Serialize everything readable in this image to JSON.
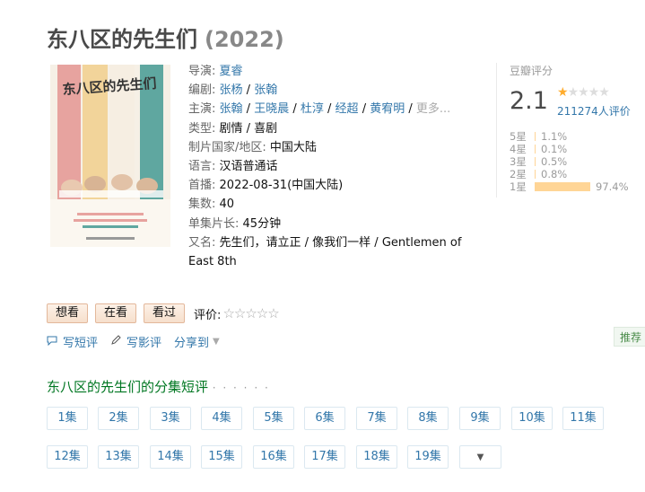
{
  "title": {
    "name": "东八区的先生们",
    "year": "(2022)"
  },
  "poster": {
    "title": "东八区的先生们"
  },
  "info": {
    "director_label": "导演:",
    "directors": [
      "夏睿"
    ],
    "writer_label": "编剧:",
    "writers": [
      "张杨",
      "张翰"
    ],
    "cast_label": "主演:",
    "cast": [
      "张翰",
      "王晓晨",
      "杜淳",
      "经超",
      "黄宥明"
    ],
    "cast_more": "更多...",
    "genre_label": "类型:",
    "genre": "剧情 / 喜剧",
    "country_label": "制片国家/地区:",
    "country": "中国大陆",
    "language_label": "语言:",
    "language": "汉语普通话",
    "premiere_label": "首播:",
    "premiere": "2022-08-31(中国大陆)",
    "episodes_label": "集数:",
    "episodes": "40",
    "runtime_label": "单集片长:",
    "runtime": "45分钟",
    "aka_label": "又名:",
    "aka": "先生们，请立正 / 像我们一样 / Gentlemen of East 8th"
  },
  "rating": {
    "label": "豆瓣评分",
    "score": "2.1",
    "stars_value": 1,
    "stars_max": 5,
    "count": "211274人评价",
    "distribution": [
      {
        "label": "5星",
        "percent": "1.1%",
        "value": 1.1
      },
      {
        "label": "4星",
        "percent": "0.1%",
        "value": 0.1
      },
      {
        "label": "3星",
        "percent": "0.5%",
        "value": 0.5
      },
      {
        "label": "2星",
        "percent": "0.8%",
        "value": 0.8
      },
      {
        "label": "1星",
        "percent": "97.4%",
        "value": 97.4
      }
    ]
  },
  "actions": {
    "want": "想看",
    "watching": "在看",
    "watched": "看过",
    "rate_label": "评价:",
    "rate_stars": "☆☆☆☆☆"
  },
  "share": {
    "short_review": "写短评",
    "review": "写影评",
    "share": "分享到"
  },
  "recommend": "推荐",
  "episodes_section": {
    "title": "东八区的先生们的分集短评",
    "dots": "· · · · · ·",
    "episodes": [
      "1集",
      "2集",
      "3集",
      "4集",
      "5集",
      "6集",
      "7集",
      "8集",
      "9集",
      "10集",
      "11集",
      "12集",
      "13集",
      "14集",
      "15集",
      "16集",
      "17集",
      "18集",
      "19集"
    ]
  },
  "colors": {
    "link": "#3377aa",
    "star_on": "#ffac2d",
    "bar": "#ffd596",
    "section_green": "#007722"
  }
}
